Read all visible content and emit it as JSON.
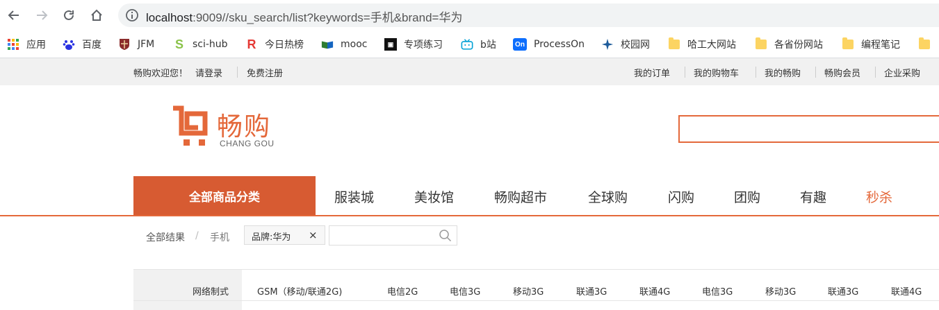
{
  "browser": {
    "url_host": "localhost",
    "url_rest": ":9009//sku_search/list?keywords=手机&brand=华为"
  },
  "bookmarks": [
    {
      "label": "应用",
      "icon": "apps-grid-icon"
    },
    {
      "label": "百度",
      "icon": "baidu-paw-icon"
    },
    {
      "label": "JFM",
      "icon": "crest-icon"
    },
    {
      "label": "sci-hub",
      "icon": "scihub-s-icon"
    },
    {
      "label": "今日热榜",
      "icon": "r-logo-icon"
    },
    {
      "label": "mooc",
      "icon": "book-icon"
    },
    {
      "label": "专项练习",
      "icon": "game-icon"
    },
    {
      "label": "b站",
      "icon": "bilibili-icon"
    },
    {
      "label": "ProcessOn",
      "icon": "on-logo-icon"
    },
    {
      "label": "校园网",
      "icon": "compass-icon"
    },
    {
      "label": "哈工大网站",
      "icon": "folder-icon"
    },
    {
      "label": "各省份网站",
      "icon": "folder-icon"
    },
    {
      "label": "编程笔记",
      "icon": "folder-icon"
    }
  ],
  "topbar": {
    "welcome": "畅购欢迎您！",
    "login": "请登录",
    "register": "免费注册",
    "links": [
      "我的订单",
      "我的购物车",
      "我的畅购",
      "畅购会员",
      "企业采购"
    ]
  },
  "logo": {
    "cn": "畅购",
    "en": "CHANG GOU"
  },
  "nav": {
    "category_button": "全部商品分类",
    "items": [
      "服装城",
      "美妆馆",
      "畅购超市",
      "全球购",
      "闪购",
      "团购",
      "有趣",
      "秒杀"
    ]
  },
  "breadcrumb": {
    "all": "全部结果",
    "sep": "/",
    "keyword": "手机",
    "tag": "品牌:华为",
    "tag_close": "×"
  },
  "attributes": {
    "key": "网络制式",
    "values": [
      "GSM（移动/联通2G)",
      "电信2G",
      "电信3G",
      "移动3G",
      "联通3G",
      "联通4G",
      "电信3G",
      "移动3G",
      "联通3G",
      "联通4G"
    ]
  },
  "colors": {
    "accent": "#e4683a",
    "category_bg": "#d75b32"
  }
}
